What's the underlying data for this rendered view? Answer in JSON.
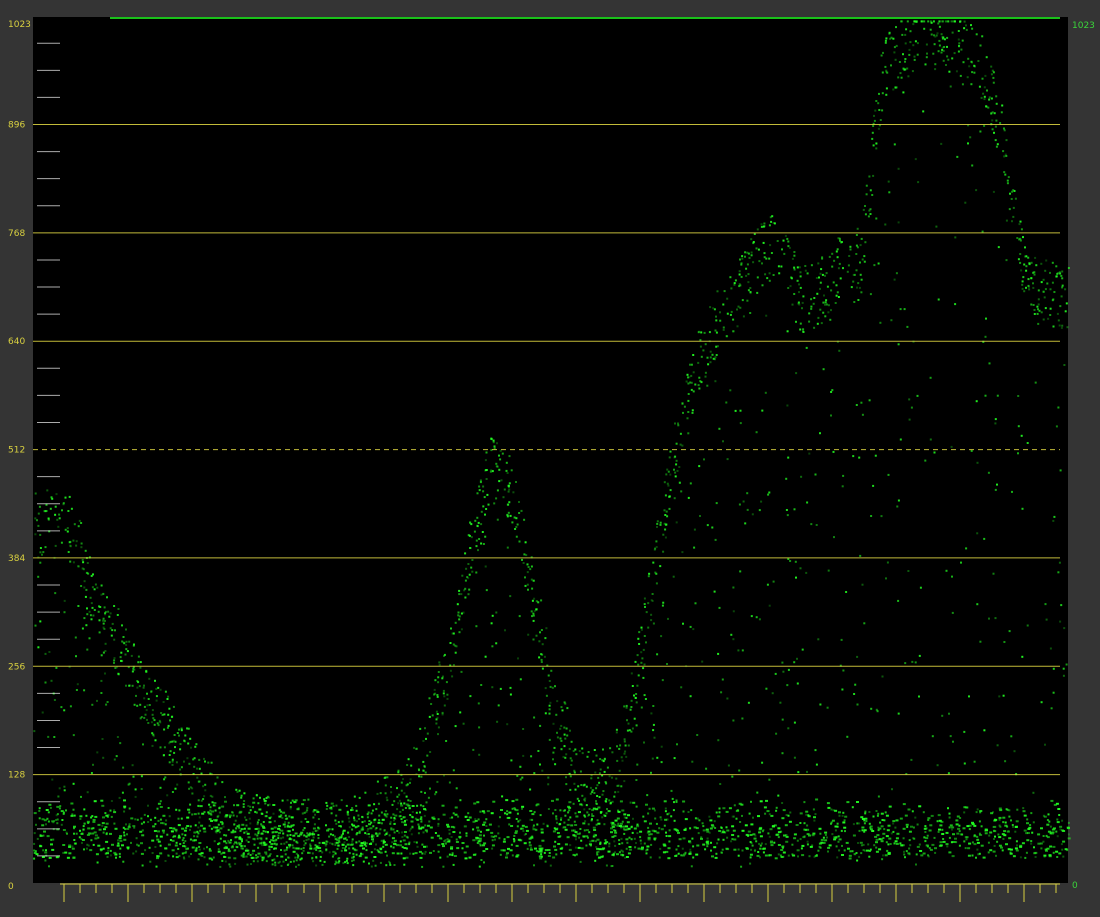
{
  "chart_data": {
    "type": "scatter",
    "title": "",
    "xlabel": "",
    "ylabel": "",
    "ylim": [
      0,
      1023
    ],
    "left_axis_ticks": [
      0,
      128,
      256,
      384,
      512,
      640,
      768,
      896,
      1023
    ],
    "right_axis_labels": {
      "top": "1023",
      "bottom": "0"
    },
    "dashed_reference_level": 512,
    "grid": true,
    "trace_color": "#22ff22",
    "graticule_color": "#d8d040",
    "right_label_color": "#3ad43a",
    "background": "#000000",
    "frame": "#343434",
    "series": [
      {
        "profile": [
          [
            0.0,
            420
          ],
          [
            0.02,
            440
          ],
          [
            0.04,
            410
          ],
          [
            0.06,
            330
          ],
          [
            0.08,
            290
          ],
          [
            0.1,
            240
          ],
          [
            0.12,
            200
          ],
          [
            0.14,
            170
          ],
          [
            0.16,
            130
          ],
          [
            0.18,
            90
          ],
          [
            0.2,
            70
          ],
          [
            0.24,
            60
          ],
          [
            0.28,
            60
          ],
          [
            0.32,
            70
          ],
          [
            0.36,
            110
          ],
          [
            0.38,
            170
          ],
          [
            0.4,
            260
          ],
          [
            0.42,
            380
          ],
          [
            0.44,
            490
          ],
          [
            0.46,
            470
          ],
          [
            0.48,
            360
          ],
          [
            0.5,
            230
          ],
          [
            0.52,
            150
          ],
          [
            0.54,
            120
          ],
          [
            0.56,
            130
          ],
          [
            0.58,
            220
          ],
          [
            0.6,
            380
          ],
          [
            0.62,
            510
          ],
          [
            0.64,
            610
          ],
          [
            0.66,
            660
          ],
          [
            0.68,
            700
          ],
          [
            0.7,
            740
          ],
          [
            0.72,
            760
          ],
          [
            0.74,
            690
          ],
          [
            0.76,
            700
          ],
          [
            0.78,
            730
          ],
          [
            0.8,
            740
          ],
          [
            0.82,
            960
          ],
          [
            0.84,
            990
          ],
          [
            0.86,
            1005
          ],
          [
            0.88,
            1000
          ],
          [
            0.9,
            990
          ],
          [
            0.92,
            960
          ],
          [
            0.94,
            860
          ],
          [
            0.96,
            700
          ],
          [
            0.98,
            700
          ],
          [
            1.0,
            690
          ]
        ]
      }
    ]
  }
}
